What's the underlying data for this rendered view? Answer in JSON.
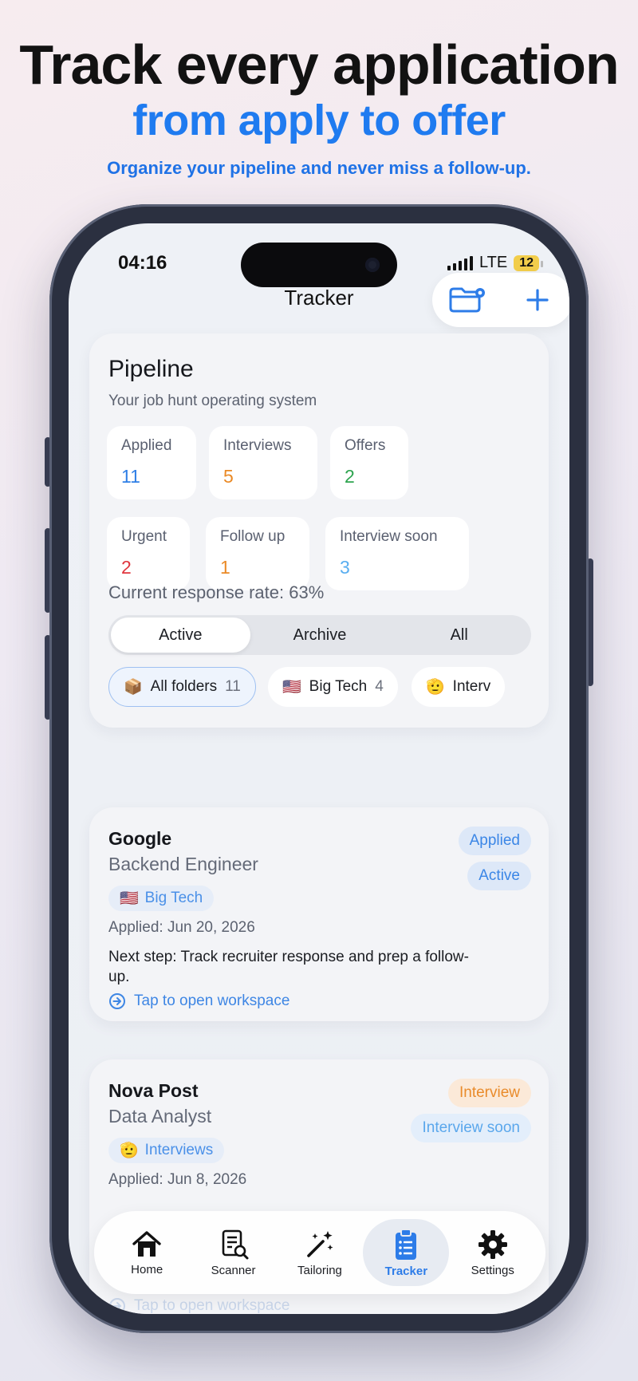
{
  "marketing": {
    "headline": "Track every application",
    "headline_accent": "from apply to offer",
    "subheadline": "Organize your pipeline and never miss a follow-up."
  },
  "status_bar": {
    "time": "04:16",
    "network": "LTE",
    "battery": "12"
  },
  "nav": {
    "title": "Tracker",
    "folder_settings_icon": "folder-gear-icon",
    "add_icon": "plus-icon"
  },
  "pipeline": {
    "title": "Pipeline",
    "subtitle": "Your job hunt operating system",
    "stats": [
      {
        "label": "Applied",
        "value": "11",
        "color": "#2f7fe6"
      },
      {
        "label": "Interviews",
        "value": "5",
        "color": "#ea8a26"
      },
      {
        "label": "Offers",
        "value": "2",
        "color": "#2ea44f"
      },
      {
        "label": "Urgent",
        "value": "2",
        "color": "#e0353d"
      },
      {
        "label": "Follow up",
        "value": "1",
        "color": "#ea8a26"
      },
      {
        "label": "Interview soon",
        "value": "3",
        "color": "#59aef0"
      }
    ],
    "response_rate": "Current response rate: 63%",
    "segments": [
      "Active",
      "Archive",
      "All"
    ],
    "selected_segment": "Active",
    "folders": [
      {
        "emoji": "📦",
        "name": "All folders",
        "count": "11"
      },
      {
        "emoji": "🇺🇸",
        "name": "Big Tech",
        "count": "4"
      },
      {
        "emoji": "🫡",
        "name": "Interv",
        "count": ""
      }
    ]
  },
  "jobs": [
    {
      "company": "Google",
      "role": "Backend Engineer",
      "folder_emoji": "🇺🇸",
      "folder": "Big Tech",
      "applied": "Applied: Jun 20, 2026",
      "next_step": "Next step: Track recruiter response and prep a follow-up.",
      "open": "Tap to open workspace",
      "badges": [
        "Applied",
        "Active"
      ]
    },
    {
      "company": "Nova Post",
      "role": "Data Analyst",
      "folder_emoji": "🫡",
      "folder": "Interviews",
      "applied": "Applied: Jun 8, 2026",
      "open": "Tap to open workspace",
      "badges": [
        "Interview",
        "Interview soon"
      ]
    }
  ],
  "tabbar": {
    "items": [
      {
        "label": "Home",
        "icon": "house-icon"
      },
      {
        "label": "Scanner",
        "icon": "document-search-icon"
      },
      {
        "label": "Tailoring",
        "icon": "magic-wand-icon"
      },
      {
        "label": "Tracker",
        "icon": "clipboard-list-icon"
      },
      {
        "label": "Settings",
        "icon": "gear-icon"
      }
    ],
    "selected": "Tracker"
  }
}
